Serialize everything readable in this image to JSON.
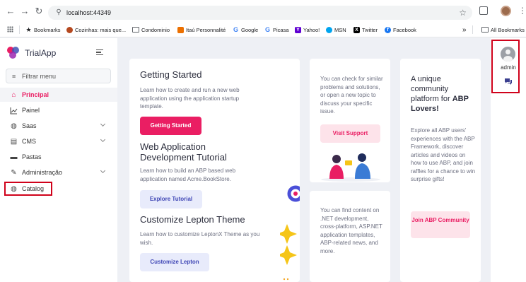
{
  "browser": {
    "url": "localhost:44349",
    "bookmarks": [
      {
        "label": "Bookmarks",
        "icon": "star-icon"
      },
      {
        "label": "Cozinhas: mais que...",
        "icon": "site-icon"
      },
      {
        "label": "Condominio",
        "icon": "folder-icon"
      },
      {
        "label": "Itaú Personnalité",
        "icon": "itau-icon"
      },
      {
        "label": "Google",
        "icon": "google-icon"
      },
      {
        "label": "Picasa",
        "icon": "google-icon"
      },
      {
        "label": "Yahoo!",
        "icon": "yahoo-icon"
      },
      {
        "label": "MSN",
        "icon": "msn-icon"
      },
      {
        "label": "Twitter",
        "icon": "x-icon"
      },
      {
        "label": "Facebook",
        "icon": "facebook-icon"
      }
    ],
    "overflow": "»",
    "all_bookmarks": "All Bookmarks"
  },
  "app": {
    "brand": "TrialApp",
    "filter_placeholder": "Filtrar menu",
    "menu": [
      {
        "label": "Principal",
        "icon": "home-icon",
        "active": true,
        "has_children": false
      },
      {
        "label": "Painel",
        "icon": "chart-icon",
        "active": false,
        "has_children": false
      },
      {
        "label": "Saas",
        "icon": "globe-icon",
        "active": false,
        "has_children": true
      },
      {
        "label": "CMS",
        "icon": "server-icon",
        "active": false,
        "has_children": true
      },
      {
        "label": "Pastas",
        "icon": "folder-icon",
        "active": false,
        "has_children": false
      },
      {
        "label": "Administração",
        "icon": "wrench-icon",
        "active": false,
        "has_children": true
      },
      {
        "label": "Catalog",
        "icon": "globe-icon",
        "active": false,
        "has_children": false
      }
    ],
    "user": "admin"
  },
  "content": {
    "getting_started": {
      "title": "Getting Started",
      "text": "Learn how to create and run a new web application using the application startup template.",
      "button": "Getting Started"
    },
    "tutorial": {
      "title": "Web Application Development Tutorial",
      "text": "Learn how to build an ABP based web application named Acme.BookStore.",
      "button": "Explore Tutorial"
    },
    "lepton": {
      "title": "Customize Lepton Theme",
      "text": "Learn how to customize LeptonX Theme as you wish.",
      "button": "Customize Lepton"
    },
    "support": {
      "text": "You can check for similar problems and solutions, or open a new topic to discuss your specific issue.",
      "button": "Visit Support"
    },
    "community_news": {
      "text": "You can find content on .NET development, cross-platform, ASP.NET application templates, ABP-related news, and more."
    },
    "abp_lovers": {
      "title_prefix": "A unique community platform for ",
      "title_emphasis": "ABP Lovers!",
      "text": "Explore all ABP users' experiences with the ABP Framework, discover articles and videos on how to use ABP, and join raffles for a chance to win surprise gifts!",
      "button": "Join ABP Community"
    }
  },
  "colors": {
    "accent": "#ea1e63",
    "highlight": "#d0021b"
  }
}
